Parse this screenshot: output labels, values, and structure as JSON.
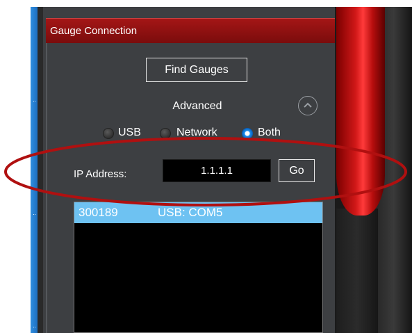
{
  "panel": {
    "title": "Gauge Connection",
    "find_button_label": "Find Gauges",
    "advanced_label": "Advanced",
    "advanced_expanded": false,
    "connection_options": [
      {
        "label": "USB",
        "selected": false
      },
      {
        "label": "Network",
        "selected": false
      },
      {
        "label": "Both",
        "selected": true
      }
    ],
    "ip_label": "IP Address:",
    "ip_value": "1.1.1.1",
    "go_button_label": "Go",
    "devices": [
      {
        "serial": "300189",
        "port": "USB: COM5",
        "selected": true
      }
    ]
  },
  "colors": {
    "header": "#8e1010",
    "panel_bg": "#3d3f42",
    "selection": "#6ec2f2",
    "annotation": "#b01010",
    "accent_blue": "#1e6fc0"
  },
  "icons": {
    "expand": "chevron-up-circle-icon",
    "grip": "grip-dots-icon"
  }
}
